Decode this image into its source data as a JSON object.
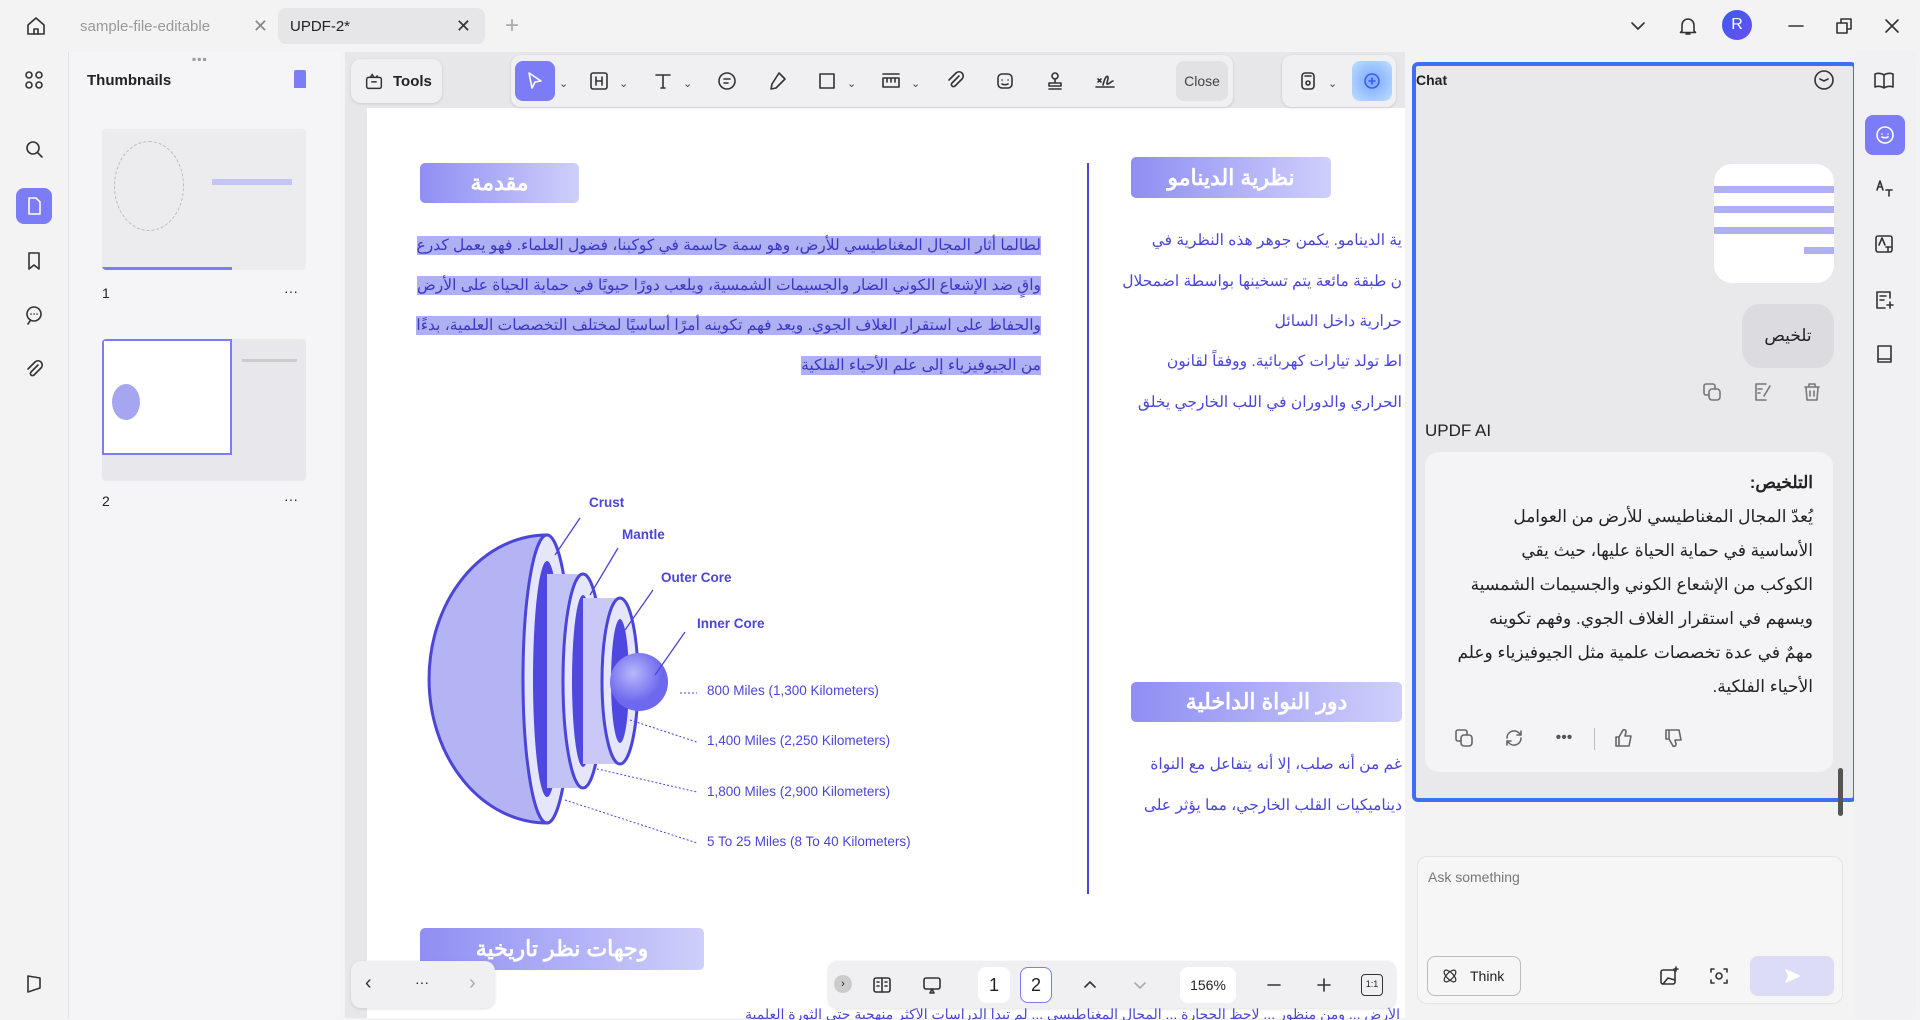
{
  "tabs": [
    {
      "label": "sample-file-editable",
      "active": false
    },
    {
      "label": "UPDF-2*",
      "active": true
    }
  ],
  "user_avatar": "R",
  "thumbnails": {
    "title": "Thumbnails",
    "pages": [
      {
        "number": "1"
      },
      {
        "number": "2",
        "selected": true
      }
    ],
    "more": "···"
  },
  "toolbar": {
    "tools_label": "Tools",
    "close_label": "Close"
  },
  "document": {
    "intro_heading": "مقدمة",
    "intro_lines": [
      "لطالما أثار المجال المغناطيسي للأرض، وهو سمة حاسمة في كوكبنا، فضول العلماء. فهو يعمل كدرع",
      "واقٍ ضد الإشعاع الكوني الضار والجسيمات الشمسية، ويلعب دورًا حيويًا في حماية الحياة على الأرض",
      "والحفاظ على استقرار الغلاف الجوي. ويعد فهم تكوينه أمرًا أساسيًا لمختلف التخصصات العلمية، بدءًا",
      "من الجيوفيزياء إلى علم الأحياء الفلكية"
    ],
    "dynamo_heading": "نظرية الدينامو",
    "dynamo_lines": [
      "ية الدينامو. يكمن جوهر هذه النظرية في",
      "ن طبقة مائعة يتم تسخينها بواسطة اضمحلال",
      "حرارية داخل السائل",
      "اط تولد تيارات كهربائية. ووفقاً لقانون",
      "الحراري والدوران في اللب الخارجي يخلق"
    ],
    "inner_core_heading": "دور النواة الداخلية",
    "inner_core_lines": [
      "غم من أنه صلب، إلا أنه يتفاعل مع النواة",
      "ديناميكيات القلب الخارجي، مما يؤثر على"
    ],
    "history_heading": "وجهات نظر تاريخية",
    "bottom_partial_line": "الأرض ... ومن منظور ... لاحظ الحجارة ... المجال المغناطيسي ... لم تبدأ الدراسات الأكثر منهجية حتى الثورة العلمية"
  },
  "diagram": {
    "layers": [
      "Crust",
      "Mantle",
      "Outer Core",
      "Inner Core"
    ],
    "measurements": [
      "800 Miles (1,300 Kilometers)",
      "1,400 Miles (2,250 Kilometers)",
      "1,800 Miles (2,900 Kilometers)",
      "5 To 25 Miles (8 To 40 Kilometers)"
    ]
  },
  "bottom_bar": {
    "pages": [
      "1",
      "2"
    ],
    "current_page": "2",
    "zoom": "156%",
    "fit_label": "1:1",
    "more": "···"
  },
  "chat": {
    "title": "Chat",
    "user_prompt": "تلخيص",
    "assistant_name": "UPDF AI",
    "response_title": "التلخيص:",
    "response_lines": [
      "يُعدّ المجال المغناطيسي للأرض من العوامل",
      "الأساسية في حماية الحياة عليها، حيث يقي",
      "الكوكب من الإشعاع الكوني والجسيمات الشمسية",
      "ويسهم في استقرار الغلاف الجوي. وفهم تكوينه",
      "مهمٌ في عدة تخصصات علمية مثل الجيوفيزياء وعلم",
      "الأحياء الفلكية."
    ],
    "input_placeholder": "Ask something",
    "think_label": "Think"
  },
  "colors": {
    "accent": "#7b7cf6",
    "panel_border": "#3d6ff0",
    "doc_text": "#4b45d8",
    "selection": "#aeb0f3"
  }
}
